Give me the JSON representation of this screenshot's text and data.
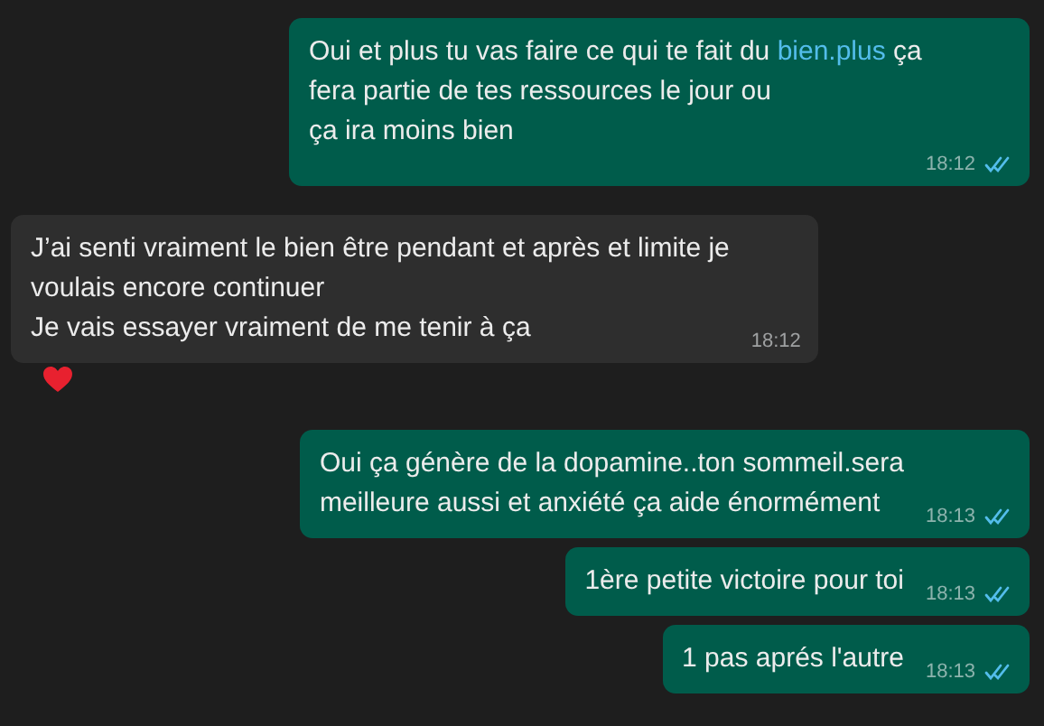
{
  "messages": [
    {
      "outgoing": true,
      "segments": [
        {
          "kind": "text",
          "text": "Oui et plus tu vas faire ce qui te fait du "
        },
        {
          "kind": "link",
          "text": "bien.plus"
        },
        {
          "kind": "text",
          "text": " ça\nfera partie de tes ressources le jour ou\nça ira moins bien"
        }
      ],
      "time": "18:12",
      "read": true
    },
    {
      "outgoing": false,
      "segments": [
        {
          "kind": "text",
          "text": "J’ai senti vraiment le bien être pendant et après et limite je\nvoulais encore continuer\nJe vais essayer vraiment de me tenir à ça"
        }
      ],
      "time": "18:12",
      "reaction": {
        "kind": "heart"
      }
    },
    {
      "outgoing": true,
      "segments": [
        {
          "kind": "text",
          "text": "Oui ça génère de la dopamine..ton sommeil.sera\nmeilleure aussi et anxiété ça aide énormément"
        }
      ],
      "time": "18:13",
      "read": true
    },
    {
      "outgoing": true,
      "segments": [
        {
          "kind": "text",
          "text": "1ère petite victoire pour toi"
        }
      ],
      "time": "18:13",
      "read": true
    },
    {
      "outgoing": true,
      "segments": [
        {
          "kind": "text",
          "text": "1 pas aprés l'autre"
        }
      ],
      "time": "18:13",
      "read": true
    }
  ]
}
